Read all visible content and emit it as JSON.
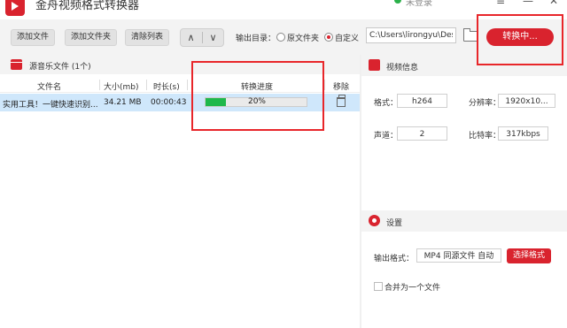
{
  "app": {
    "title": "金舟视频格式转换器",
    "status_text": "未登录"
  },
  "toolbar": {
    "add_file": "添加文件",
    "add_folder": "添加文件夹",
    "clear_list": "清除列表",
    "up_arrow": "∧",
    "down_arrow": "∨",
    "output_label": "输出目录：",
    "radio_original": "原文件夹",
    "radio_custom": "自定义",
    "output_path": "C:\\Users\\lirongyu\\Desk",
    "convert_button": "转换中..."
  },
  "file_list": {
    "title": "源音乐文件 (1个)",
    "columns": [
      "文件名",
      "大小(mb)",
      "时长(s)",
      "转换进度",
      "移除"
    ],
    "rows": [
      {
        "name": "实用工具！一键快速识别...",
        "size": "34.21 MB",
        "duration": "00:00:43",
        "progress_text": "20%",
        "progress": 0.2
      }
    ]
  },
  "video_info": {
    "title": "视频信息",
    "format_label": "格式：",
    "format_value": "h264",
    "resolution_label": "分辨率：",
    "resolution_value": "1920x10...",
    "channel_label": "声道：",
    "channel_value": "2",
    "bitrate_label": "比特率：",
    "bitrate_value": "317kbps"
  },
  "settings": {
    "title": "设置",
    "output_format_label": "输出格式：",
    "output_format_value": "MP4 同源文件 自动",
    "select_format_button": "选择格式",
    "merge_label": "合并为一个文件"
  },
  "colors": {
    "accent": "#d9232e",
    "progress": "#1fb84b",
    "selected_row": "#cfe7fb",
    "annotation": "#e8262a"
  }
}
